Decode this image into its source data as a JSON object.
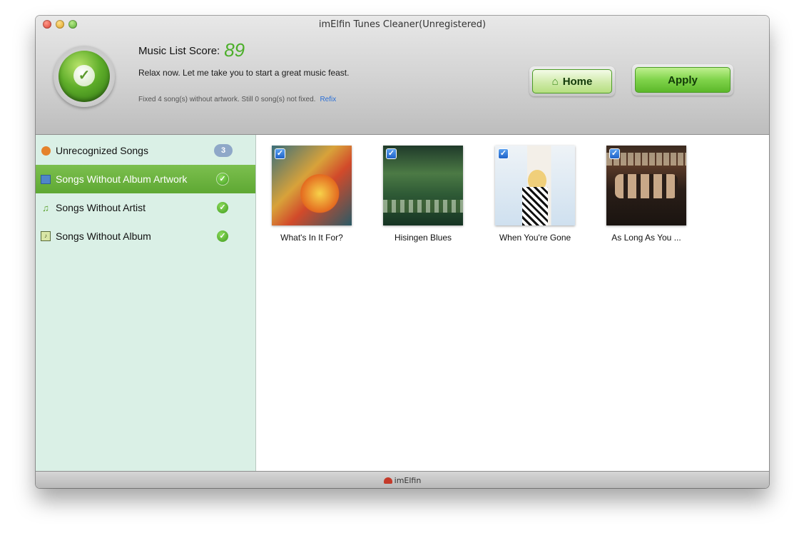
{
  "window": {
    "title": "imElfin Tunes Cleaner(Unregistered)"
  },
  "header": {
    "score_label": "Music List Score:",
    "score_value": "89",
    "tagline": "Relax now. Let me take you to start a great music feast.",
    "fix_info": "Fixed 4 song(s) without artwork. Still 0 song(s) not fixed.",
    "refix_label": "Refix",
    "home_label": "Home",
    "apply_label": "Apply"
  },
  "sidebar": {
    "items": [
      {
        "label": "Unrecognized Songs",
        "count": "3",
        "icon": "unrecognized-icon"
      },
      {
        "label": "Songs Without Album Artwork",
        "icon": "artwork-icon",
        "selected": true
      },
      {
        "label": "Songs Without Artist",
        "icon": "artist-icon"
      },
      {
        "label": "Songs Without Album",
        "icon": "album-icon"
      }
    ]
  },
  "albums": [
    {
      "title": "What's In It For?",
      "checked": true
    },
    {
      "title": "Hisingen Blues",
      "checked": true
    },
    {
      "title": "When You're Gone",
      "checked": true
    },
    {
      "title": "As Long As You ...",
      "checked": true
    }
  ],
  "footer": {
    "brand": "imElfin"
  },
  "colors": {
    "accent_green": "#5ea833",
    "score_green": "#4caf2a",
    "sidebar_bg": "#daf0e6",
    "link_blue": "#2b6fd6"
  }
}
